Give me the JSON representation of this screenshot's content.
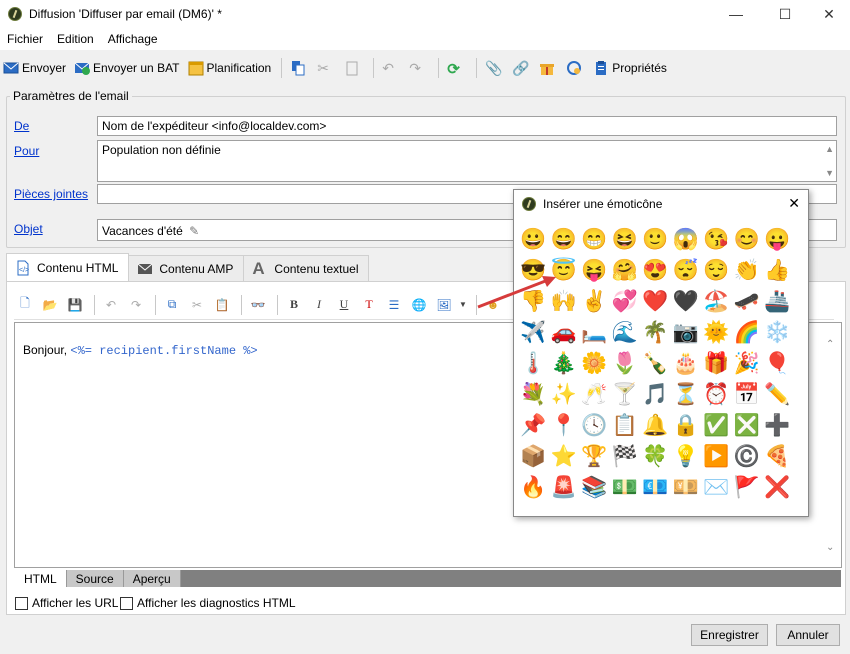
{
  "window": {
    "title": "Diffusion 'Diffuser par email (DM6)' *",
    "controls": [
      "—",
      "☐",
      "✕"
    ]
  },
  "menu": [
    "Fichier",
    "Edition",
    "Affichage"
  ],
  "toolbar": {
    "send": "Envoyer",
    "send_proof": "Envoyer un BAT",
    "planning": "Planification",
    "properties": "Propriétés"
  },
  "email": {
    "section_title": "Paramètres de l'email",
    "from_label": "De",
    "from_value": "Nom de l'expéditeur <info@localdev.com>",
    "to_label": "Pour",
    "to_value": "Population non définie",
    "attachments_label": "Pièces jointes",
    "attachments_value": "",
    "subject_label": "Objet",
    "subject_value": "Vacances d'été"
  },
  "tabs": [
    "Contenu HTML",
    "Contenu AMP",
    "Contenu textuel"
  ],
  "editor": {
    "greeting": "Bonjour,",
    "code": "<%= recipient.firstName %>",
    "view_tabs": [
      "HTML",
      "Source",
      "Aperçu"
    ]
  },
  "options": {
    "show_urls": "Afficher les URL",
    "show_diag": "Afficher les diagnostics HTML"
  },
  "buttons": {
    "save": "Enregistrer",
    "cancel": "Annuler"
  },
  "emoticon_popup": {
    "title": "Insérer une émoticône",
    "emojis": [
      "😀",
      "😄",
      "😁",
      "😆",
      "🙂",
      "😱",
      "😘",
      "😊",
      "😛",
      "😎",
      "😇",
      "😝",
      "🤗",
      "😍",
      "😴",
      "😌",
      "👏",
      "👍",
      "👎",
      "🙌",
      "✌️",
      "💞",
      "❤️",
      "🖤",
      "🏖️",
      "🛹",
      "🚢",
      "✈️",
      "🚗",
      "🛏️",
      "🌊",
      "🌴",
      "📷",
      "🌞",
      "🌈",
      "❄️",
      "🌡️",
      "🎄",
      "🌼",
      "🌷",
      "🍾",
      "🎂",
      "🎁",
      "🎉",
      "🎈",
      "💐",
      "✨",
      "🥂",
      "🍸",
      "🎵",
      "⏳",
      "⏰",
      "📅",
      "✏️",
      "📌",
      "📍",
      "🕓",
      "📋",
      "🔔",
      "🔒",
      "✅",
      "❎",
      "➕",
      "📦",
      "⭐",
      "🏆",
      "🏁",
      "🍀",
      "💡",
      "▶️",
      "©️",
      "🍕",
      "🔥",
      "🚨",
      "📚",
      "💵",
      "💶",
      "💴",
      "✉️",
      "🚩",
      "❌"
    ]
  }
}
